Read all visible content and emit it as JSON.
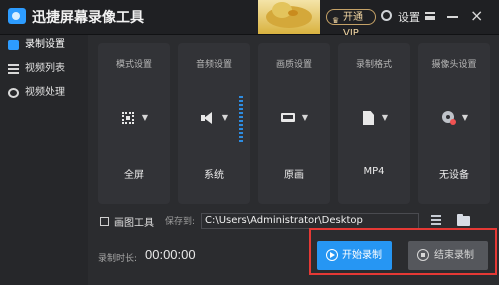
{
  "app": {
    "title": "迅捷屏幕录像工具",
    "vip_label": "开通VIP",
    "settings_label": "设置"
  },
  "sidebar": {
    "items": [
      {
        "label": "录制设置",
        "icon": "record-icon",
        "active": true
      },
      {
        "label": "视频列表",
        "icon": "list-icon",
        "active": false
      },
      {
        "label": "视频处理",
        "icon": "video-process-icon",
        "active": false
      }
    ]
  },
  "cards": [
    {
      "title": "模式设置",
      "value": "全屏",
      "icon": "fullscreen-icon"
    },
    {
      "title": "音频设置",
      "value": "系统",
      "icon": "speaker-icon"
    },
    {
      "title": "画质设置",
      "value": "原画",
      "icon": "laptop-icon"
    },
    {
      "title": "录制格式",
      "value": "MP4",
      "icon": "file-icon"
    },
    {
      "title": "摄像头设置",
      "value": "无设备",
      "icon": "camera-icon"
    }
  ],
  "options": {
    "draw_tool_label": "画图工具",
    "save_to_label": "保存到:",
    "save_path": "C:\\Users\\Administrator\\Desktop"
  },
  "record": {
    "duration_label": "录制时长:",
    "duration_value": "00:00:00",
    "start_label": "开始录制",
    "stop_label": "结束录制"
  },
  "colors": {
    "accent": "#2696f3",
    "highlight_border": "#e53935",
    "background": "#2a2b2e"
  }
}
